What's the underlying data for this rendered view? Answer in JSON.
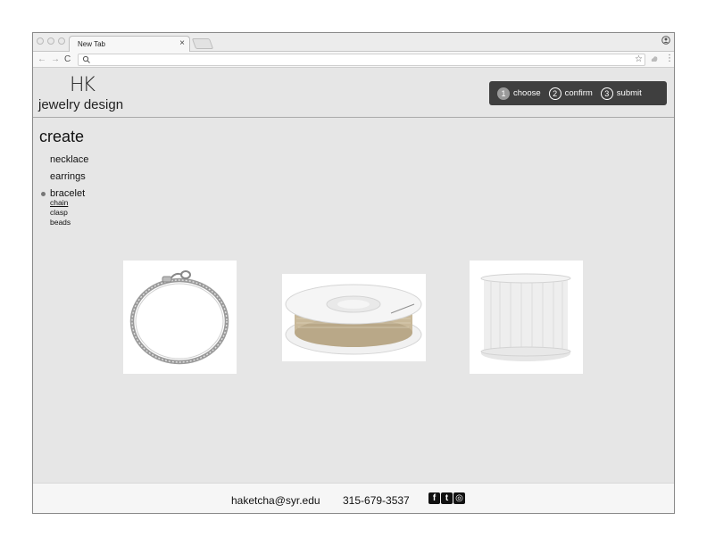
{
  "browser": {
    "tab_title": "New Tab",
    "tab_close": "×",
    "nav_back": "←",
    "nav_forward": "→",
    "nav_reload": "C",
    "star": "☆",
    "menu": "⋮"
  },
  "site": {
    "logo_mark": "HK",
    "logo_text": "jewelry design",
    "steps": [
      {
        "num": "1",
        "label": "choose",
        "active": true
      },
      {
        "num": "2",
        "label": "confirm",
        "active": false
      },
      {
        "num": "3",
        "label": "submit",
        "active": false
      }
    ]
  },
  "sidebar": {
    "heading": "create",
    "items": [
      {
        "label": "necklace"
      },
      {
        "label": "earrings"
      },
      {
        "label": "bracelet",
        "current": true
      }
    ],
    "subitems": [
      {
        "label": "chain",
        "selected": true
      },
      {
        "label": "clasp"
      },
      {
        "label": "beads"
      }
    ]
  },
  "products": [
    {
      "icon": "chain-bracelet-image"
    },
    {
      "icon": "wire-spool-image"
    },
    {
      "icon": "elastic-cord-spool-image"
    }
  ],
  "footer": {
    "email": "haketcha@syr.edu",
    "phone": "315-679-3537",
    "social": [
      {
        "icon": "facebook-icon",
        "glyph": "f"
      },
      {
        "icon": "twitter-icon",
        "glyph": "t"
      },
      {
        "icon": "instagram-icon",
        "glyph": "◎"
      }
    ]
  },
  "colors": {
    "page_bg": "#e6e6e6",
    "step_bar": "#3f3f3f",
    "active_step": "#9a9a9a"
  }
}
